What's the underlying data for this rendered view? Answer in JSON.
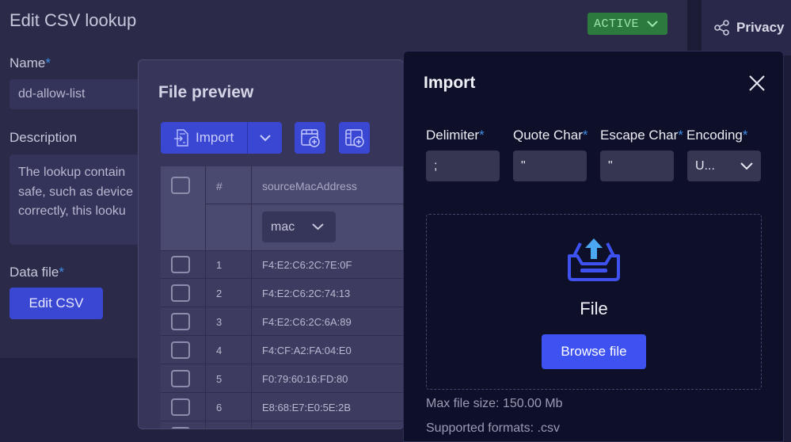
{
  "edit": {
    "title": "Edit CSV lookup",
    "status_badge": "ACTIVE",
    "name_label": "Name",
    "name_value": "dd-allow-list",
    "description_label": "Description",
    "description_lines": [
      "The lookup contain",
      "safe, such as device",
      "correctly, this looku"
    ],
    "data_file_label": "Data file",
    "edit_csv_button": "Edit CSV",
    "required_mark": "*"
  },
  "privacy": {
    "label": "Privacy",
    "icon": "share-icon"
  },
  "file_preview": {
    "title": "File preview",
    "import_button": "Import",
    "columns": [
      "#",
      "sourceMacAddress"
    ],
    "type_select": "mac",
    "rows": [
      {
        "num": "1",
        "mac": "F4:E2:C6:2C:7E:0F"
      },
      {
        "num": "2",
        "mac": "F4:E2:C6:2C:74:13"
      },
      {
        "num": "3",
        "mac": "F4:E2:C6:2C:6A:89"
      },
      {
        "num": "4",
        "mac": "F4:CF:A2:FA:04:E0"
      },
      {
        "num": "5",
        "mac": "F0:79:60:16:FD:80"
      },
      {
        "num": "6",
        "mac": "E8:68:E7:E0:5E:2B"
      }
    ]
  },
  "import_dialog": {
    "title": "Import",
    "delimiter_label": "Delimiter",
    "delimiter_value": ";",
    "quote_label": "Quote Char",
    "quote_value": "\"",
    "escape_label": "Escape Char",
    "escape_value": "\"",
    "encoding_label": "Encoding",
    "encoding_value": "U...",
    "drop_title": "File",
    "browse_button": "Browse file",
    "max_size": "Max file size: 150.00 Mb",
    "formats": "Supported formats: .csv"
  },
  "colors": {
    "accent": "#3a47d3",
    "active_badge": "#2d7a3e",
    "required": "#3d8fe6"
  }
}
